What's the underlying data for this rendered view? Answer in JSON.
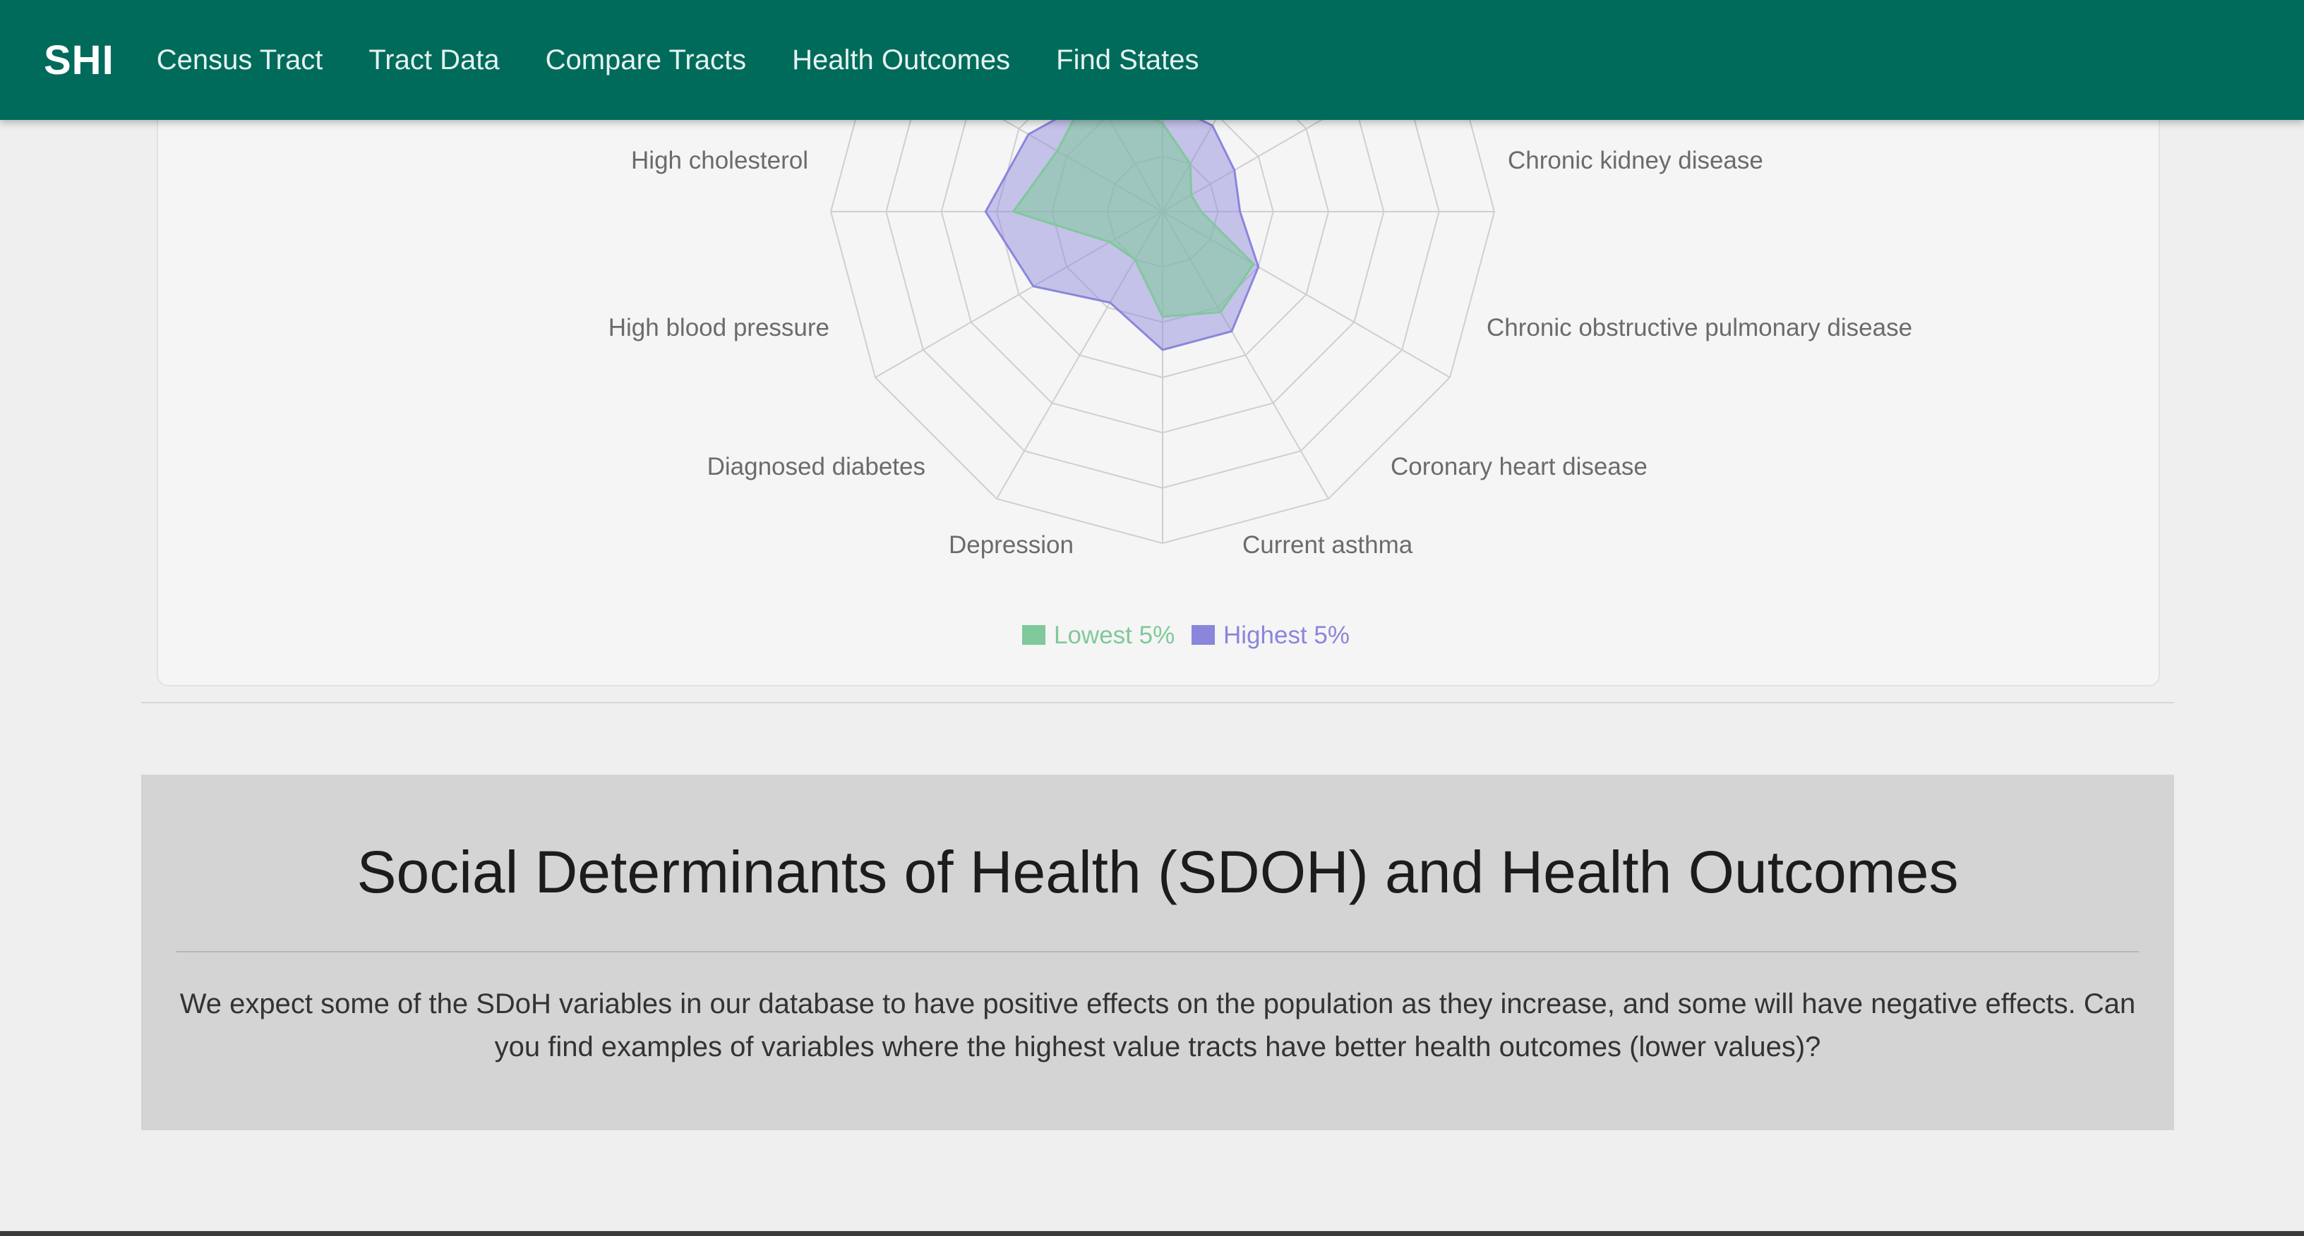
{
  "navbar": {
    "brand": "SHI",
    "links": [
      "Census Tract",
      "Tract Data",
      "Compare Tracts",
      "Health Outcomes",
      "Find States"
    ],
    "background_color": "#006b5b"
  },
  "chart_data": {
    "type": "radar",
    "axes": [
      "Chronic kidney disease",
      "Chronic obstructive pulmonary disease",
      "Coronary heart disease",
      "Current asthma",
      "Depression",
      "Diagnosed diabetes",
      "High blood pressure",
      "High cholesterol"
    ],
    "radial_ticks": [
      "25",
      "50"
    ],
    "series": [
      {
        "name": "Lowest 5%",
        "color": "#7fc99a",
        "values": [
          6,
          7,
          19,
          21,
          19,
          10,
          11,
          27
        ]
      },
      {
        "name": "Highest 5%",
        "color": "#8a86dc",
        "values": [
          15,
          14,
          20,
          25,
          25,
          19,
          27,
          32
        ]
      }
    ],
    "legend_position": "bottom"
  },
  "sdoh": {
    "title": "Social Determinants of Health (SDOH) and Health Outcomes",
    "text": "We expect some of the SDoH variables in our database to have positive effects on the population as they increase, and some will have negative effects. Can you find examples of variables where the highest value tracts have better health outcomes (lower values)?",
    "background_color": "#d4d4d4"
  }
}
